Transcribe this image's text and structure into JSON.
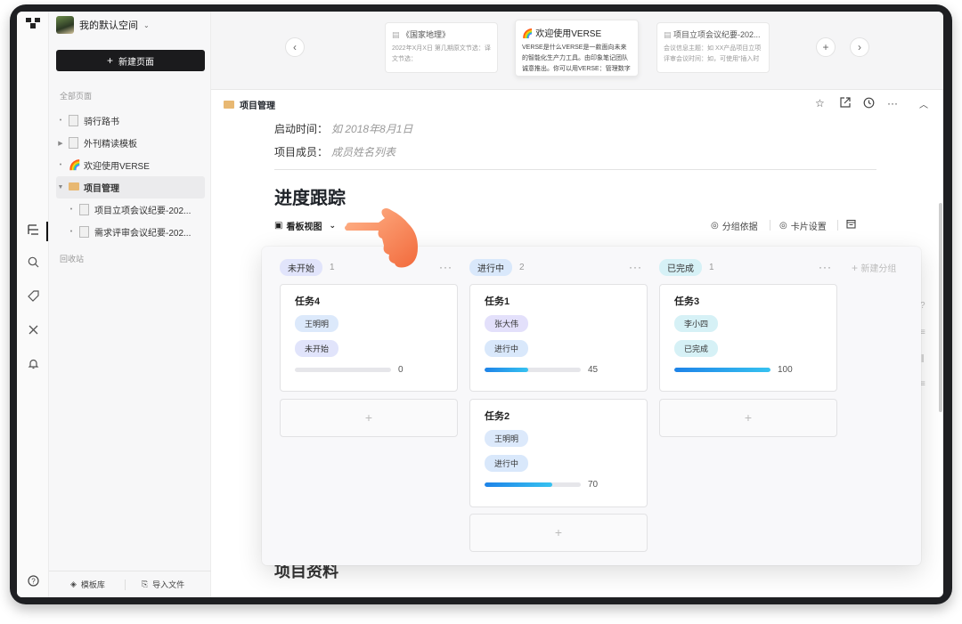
{
  "workspace": {
    "name": "我的默认空间"
  },
  "sidebar": {
    "new_page_label": "新建页面",
    "all_pages_label": "全部页面",
    "trash_label": "回收站",
    "items": [
      {
        "label": "骑行路书",
        "icon": "doc-icon"
      },
      {
        "label": "外刊精读模板",
        "icon": "doc-icon"
      },
      {
        "label": "欢迎使用VERSE",
        "icon": "rainbow-icon"
      },
      {
        "label": "项目管理",
        "icon": "folder-icon"
      },
      {
        "label": "项目立项会议纪要-202...",
        "icon": "doc-icon"
      },
      {
        "label": "需求评审会议纪要-202...",
        "icon": "doc-icon"
      }
    ],
    "footer": {
      "templates_label": "模板库",
      "import_label": "导入文件"
    }
  },
  "tabs": [
    {
      "title": "《国家地理》",
      "snippet": "2022年X月X日 第几期原文节选：译文节选："
    },
    {
      "title": "欢迎使用VERSE",
      "snippet": "VERSE是什么VERSE是一款面向未来的智能化生产力工具。由印象笔记团队诚意推出。你可以用VERSE：管理数字内"
    },
    {
      "title": "项目立项会议纪要-202...",
      "snippet": "会议信息主题：如 XX产品项目立项评审会议时间：如，可使用“插入时间”添加地点：具体会议地点参会人：参会人员"
    }
  ],
  "page": {
    "breadcrumb": "项目管理",
    "start_label": "启动时间：",
    "start_placeholder": "如 2018年8月1日",
    "members_label": "项目成员：",
    "members_placeholder": "成员姓名列表",
    "section_title": "进度跟踪",
    "next_section_title": "项目资料",
    "view_label": "看板视图",
    "group_by_label": "分组依据",
    "card_settings_label": "卡片设置"
  },
  "board": {
    "new_group_label": "新建分组",
    "add_symbol": "+",
    "columns": [
      {
        "name": "未开始",
        "count": "1",
        "color": "#e1e4fb",
        "cards": [
          {
            "title": "任务4",
            "person": "王明明",
            "person_color": "#dce9fb",
            "status": "未开始",
            "status_color": "#e1e4fb",
            "progress": 0,
            "progress_label": "0"
          }
        ]
      },
      {
        "name": "进行中",
        "count": "2",
        "color": "#d9e8fb",
        "cards": [
          {
            "title": "任务1",
            "person": "张大伟",
            "person_color": "#e3e0fb",
            "status": "进行中",
            "status_color": "#d9e8fb",
            "progress": 45,
            "progress_label": "45"
          },
          {
            "title": "任务2",
            "person": "王明明",
            "person_color": "#dce9fb",
            "status": "进行中",
            "status_color": "#d9e8fb",
            "progress": 70,
            "progress_label": "70"
          }
        ]
      },
      {
        "name": "已完成",
        "count": "1",
        "color": "#d6f1f6",
        "cards": [
          {
            "title": "任务3",
            "person": "李小四",
            "person_color": "#d6f1f6",
            "status": "已完成",
            "status_color": "#d6f1f6",
            "progress": 100,
            "progress_label": "100"
          }
        ]
      }
    ]
  }
}
